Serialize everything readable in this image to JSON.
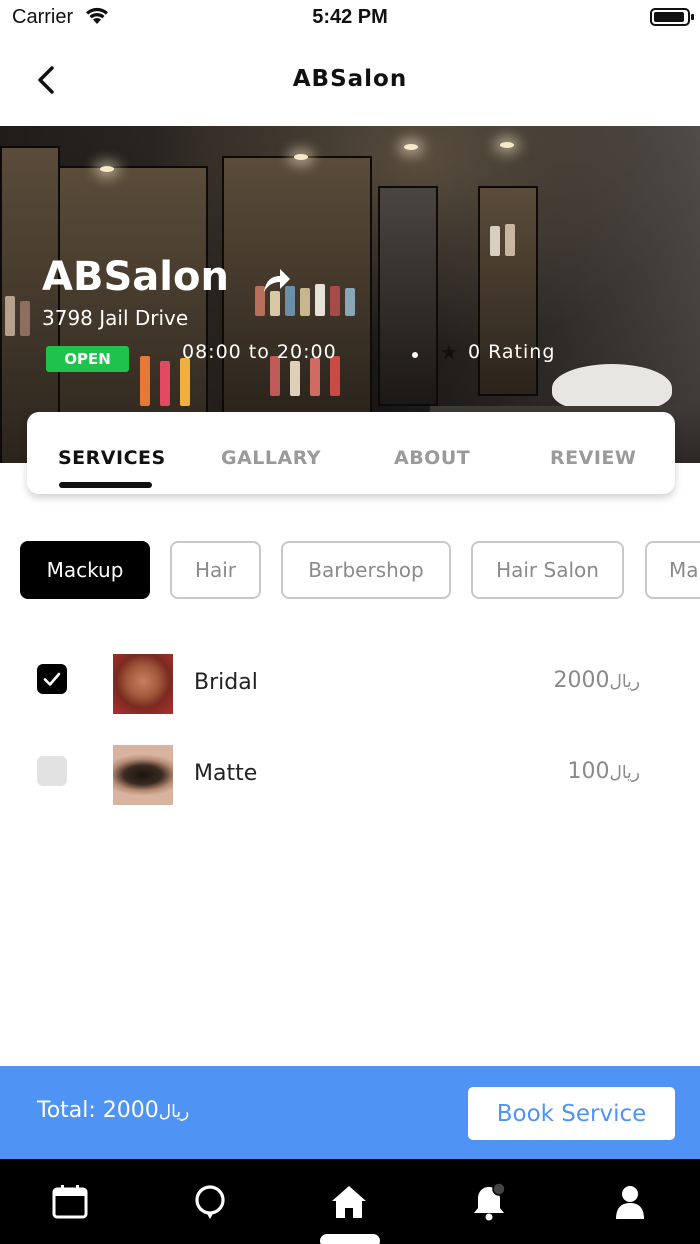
{
  "status_bar": {
    "carrier": "Carrier",
    "time": "5:42 PM"
  },
  "nav": {
    "title": "ABSalon"
  },
  "hero": {
    "name": "ABSalon",
    "address": "3798 Jail Drive",
    "status": "OPEN",
    "hours": "08:00 to 20:00",
    "rating": "0 Rating",
    "status_color": "#1fc24a"
  },
  "tabs": [
    {
      "label": "SERVICES",
      "active": true
    },
    {
      "label": "GALLARY",
      "active": false
    },
    {
      "label": "ABOUT",
      "active": false
    },
    {
      "label": "REVIEW",
      "active": false
    }
  ],
  "categories": [
    {
      "label": "Mackup",
      "active": true
    },
    {
      "label": "Hair",
      "active": false
    },
    {
      "label": "Barbershop",
      "active": false
    },
    {
      "label": "Hair Salon",
      "active": false
    },
    {
      "label": "Ma",
      "active": false
    }
  ],
  "services": [
    {
      "name": "Bridal",
      "price": "2000",
      "currency": "ريال",
      "checked": true
    },
    {
      "name": "Matte",
      "price": "100",
      "currency": "ريال",
      "checked": false
    }
  ],
  "footer": {
    "total_label": "Total: 2000",
    "currency": "ريال",
    "book_label": "Book Service",
    "accent": "#4f93f5"
  },
  "tab_bar": {
    "items": [
      "calendar-icon",
      "chat-icon",
      "home-icon",
      "bell-icon",
      "profile-icon"
    ]
  }
}
